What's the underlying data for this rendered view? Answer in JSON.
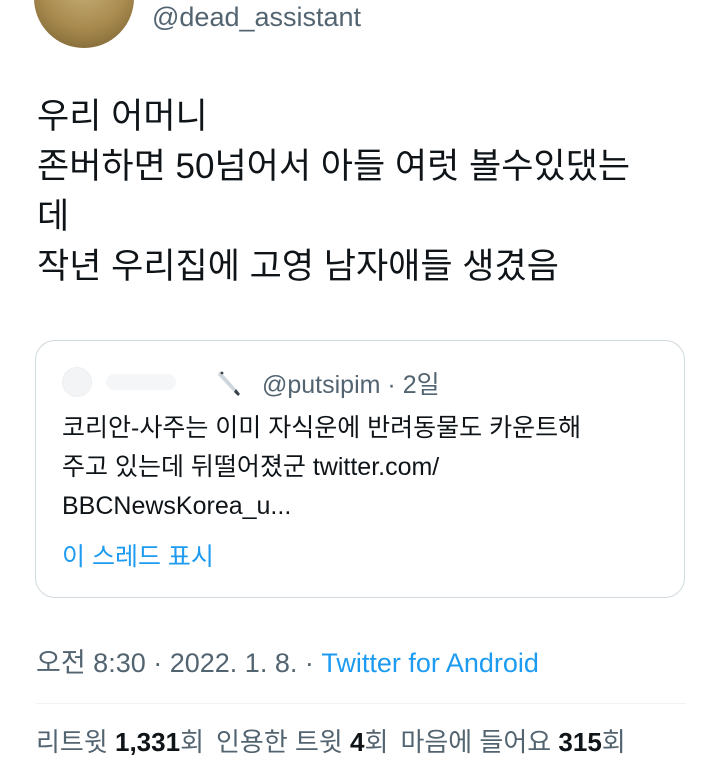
{
  "author": {
    "handle": "@dead_assistant"
  },
  "tweet": {
    "lines": [
      "우리 어머니",
      "존버하면 50넘어서 아들 여럿 볼수있댔는",
      "데",
      "작년 우리집에 고영 남자애들 생겼음"
    ]
  },
  "quote": {
    "handle": "@putsipim",
    "separator": " · ",
    "time": "2일",
    "lines": [
      "코리안-사주는 이미 자식운에 반려동물도 카운트해",
      "주고 있는데 뒤떨어졌군 twitter.com/",
      "BBCNewsKorea_u..."
    ],
    "show_thread": "이 스레드 표시"
  },
  "meta": {
    "time": "오전 8:30",
    "separator1": " · ",
    "date": "2022. 1. 8.",
    "separator2": " · ",
    "source": "Twitter for Android"
  },
  "stats": {
    "retweets_label": "리트윗 ",
    "retweets_count": "1,331",
    "retweets_suffix": "회",
    "quotes_label": "인용한 트윗 ",
    "quotes_count": "4",
    "quotes_suffix": "회",
    "likes_label": "마음에 들어요 ",
    "likes_count": "315",
    "likes_suffix": "회"
  },
  "colors": {
    "text": "#0f1419",
    "secondary": "#536471",
    "link": "#1d9bf0",
    "border": "#cfd9de"
  }
}
